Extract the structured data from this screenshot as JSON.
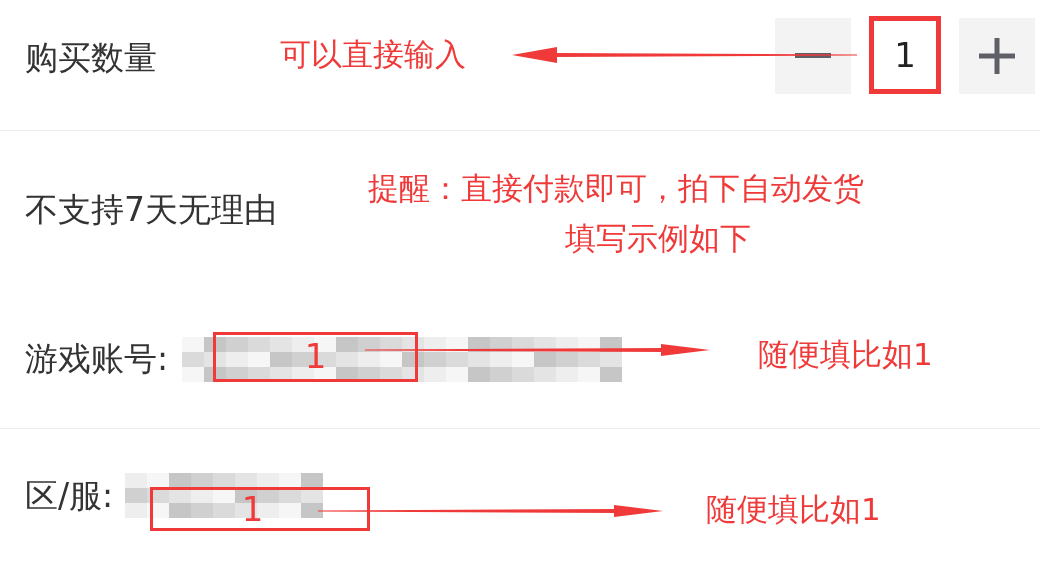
{
  "quantity": {
    "label": "购买数量",
    "value": "1"
  },
  "policy": {
    "text": "不支持7天无理由"
  },
  "fields": [
    {
      "label": "游戏账号:",
      "example": "1",
      "hint": "随便填比如1"
    },
    {
      "label": "区/服:",
      "example": "1",
      "hint": "随便填比如1"
    }
  ],
  "annotations": {
    "input_note": "可以直接输入",
    "reminder": "提醒：直接付款即可，拍下自动发货",
    "example_note": "填写示例如下"
  }
}
